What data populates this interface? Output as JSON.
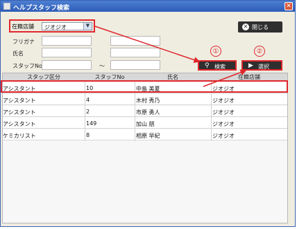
{
  "window": {
    "title": "ヘルプスタッフ検索",
    "close_glyph": "✕"
  },
  "form": {
    "store_label": "在籍店舗",
    "store_value": "ジオジオ",
    "furigana_label": "フリガナ",
    "name_label": "氏名",
    "staff_no_label": "スタッフNo.",
    "range_sep": "～"
  },
  "buttons": {
    "close_label": "閉じる",
    "search_label": "検索",
    "select_label": "選択"
  },
  "markers": {
    "one": "①",
    "two": "②"
  },
  "table": {
    "headers": [
      "スタッフ区分",
      "スタッフNo",
      "氏名",
      "在籍店舗"
    ],
    "rows": [
      [
        "アシスタント",
        "10",
        "中島 美夏",
        "ジオジオ"
      ],
      [
        "アシスタント",
        "4",
        "木村 秀乃",
        "ジオジオ"
      ],
      [
        "アシスタント",
        "2",
        "市原 勇人",
        "ジオジオ"
      ],
      [
        "アシスタント",
        "149",
        "加山 朋",
        "ジオジオ"
      ],
      [
        "ケミカリスト",
        "8",
        "相原 早紀",
        "ジオジオ"
      ]
    ]
  },
  "colors": {
    "highlight": "#e0262b",
    "titlebar": "#2d5cb7"
  },
  "icons": [
    "app-icon",
    "window-close-icon",
    "dropdown-arrow-icon",
    "close-circle-icon",
    "search-magnifier-icon",
    "select-play-icon"
  ]
}
